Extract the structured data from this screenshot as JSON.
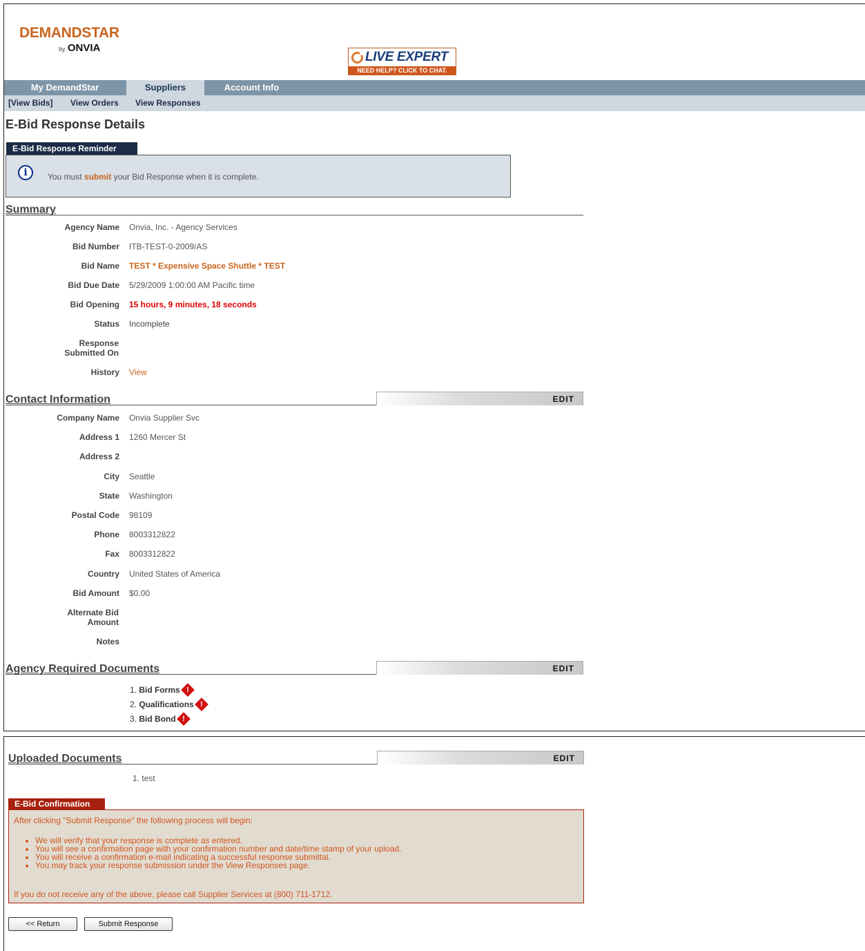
{
  "header": {
    "logo_main": "DEMANDSTAR",
    "logo_by": "by",
    "logo_onvia": "ONVIA",
    "live_expert_title": "LIVE EXPERT",
    "live_expert_sub": "NEED HELP? CLICK TO CHAT."
  },
  "nav": {
    "tabs": [
      {
        "label": "My DemandStar"
      },
      {
        "label": "Suppliers"
      },
      {
        "label": "Account Info"
      }
    ],
    "active_tab": "Suppliers",
    "subnav": [
      {
        "label": "[View Bids]"
      },
      {
        "label": "View Orders"
      },
      {
        "label": "View Responses"
      }
    ]
  },
  "page_title": "E-Bid Response Details",
  "reminder": {
    "title": "E-Bid Response Reminder",
    "text_before": "You must ",
    "link": "submit",
    "text_after": " your Bid Response when it is complete."
  },
  "summary": {
    "title": "Summary",
    "fields": [
      {
        "label": "Agency Name",
        "value": "Onvia, Inc. - Agency Services"
      },
      {
        "label": "Bid Number",
        "value": "ITB-TEST-0-2009/AS"
      },
      {
        "label": "Bid Name",
        "value": "TEST * Expensive Space Shuttle * TEST"
      },
      {
        "label": "Bid Due Date",
        "value": "5/29/2009 1:00:00 AM Pacific time"
      },
      {
        "label": "Bid Opening",
        "value": "15 hours, 9 minutes, 18 seconds"
      },
      {
        "label": "Status",
        "value": "Incomplete"
      },
      {
        "label": "Response Submitted On",
        "value": ""
      },
      {
        "label": "History",
        "value": "View"
      }
    ]
  },
  "contact": {
    "title": "Contact Information",
    "edit_label": "EDIT",
    "fields": [
      {
        "label": "Company Name",
        "value": "Onvia Supplier Svc"
      },
      {
        "label": "Address 1",
        "value": "1260 Mercer St"
      },
      {
        "label": "Address 2",
        "value": ""
      },
      {
        "label": "City",
        "value": "Seattle"
      },
      {
        "label": "State",
        "value": "Washington"
      },
      {
        "label": "Postal Code",
        "value": "98109"
      },
      {
        "label": "Phone",
        "value": "8003312822"
      },
      {
        "label": "Fax",
        "value": "8003312822"
      },
      {
        "label": "Country",
        "value": "United States of America"
      },
      {
        "label": "Bid Amount",
        "value": "$0.00"
      },
      {
        "label": "Alternate Bid Amount",
        "value": ""
      },
      {
        "label": "Notes",
        "value": ""
      }
    ]
  },
  "required_docs": {
    "title": "Agency Required Documents",
    "edit_label": "EDIT",
    "items": [
      {
        "num": "1.",
        "name": "Bid Forms"
      },
      {
        "num": "2.",
        "name": "Qualifications"
      },
      {
        "num": "3.",
        "name": "Bid Bond"
      }
    ]
  },
  "uploaded_docs": {
    "title": "Uploaded Documents",
    "edit_label": "EDIT",
    "items": [
      {
        "num": "1.",
        "name": "test"
      }
    ]
  },
  "confirmation": {
    "title": "E-Bid Confirmation",
    "intro": "After clicking \"Submit Response\" the following process will begin:",
    "bullets": [
      "We will verify that your response is complete as entered.",
      "You will see a confirmation page with your confirmation number and date/time stamp of your upload.",
      "You will receive a confirmation e-mail indicating a successful response submittal.",
      "You may track your response submission under the View Responses page."
    ],
    "outro": "If you do not receive any of the above, please call Supplier Services at (800) 711-1712."
  },
  "buttons": {
    "return_label": "<< Return",
    "submit_label": "Submit Response"
  },
  "colors": {
    "brand_orange": "#c9641e",
    "nav_blue": "#7d95a8",
    "confirm_red": "#a8200e"
  }
}
